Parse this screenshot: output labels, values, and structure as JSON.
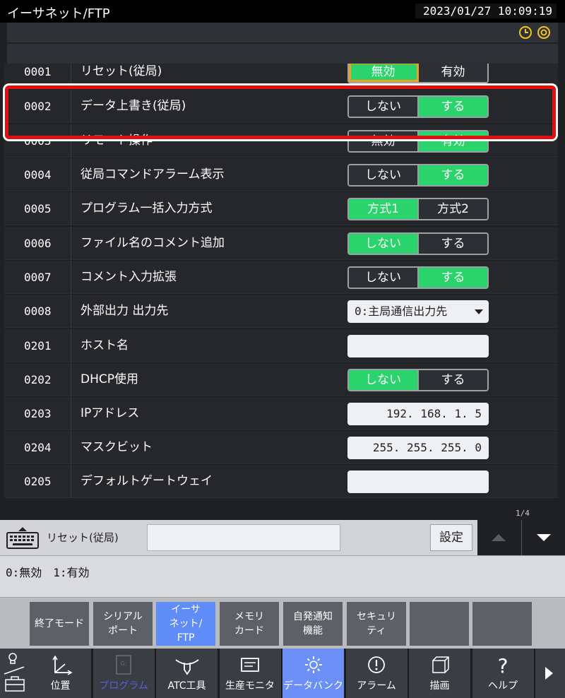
{
  "window": {
    "title": "イーサネット/FTP",
    "datetime": "2023/01/27 10:09:19"
  },
  "params": [
    {
      "no": "0001",
      "name": "リセット(従局)",
      "kind": "toggle",
      "options": [
        "無効",
        "有効"
      ],
      "selected": 0,
      "cursor": true
    },
    {
      "no": "0002",
      "name": "データ上書き(従局)",
      "kind": "toggle",
      "options": [
        "しない",
        "する"
      ],
      "selected": 1
    },
    {
      "no": "0003",
      "name": "リモート操作",
      "kind": "toggle",
      "options": [
        "無効",
        "有効"
      ],
      "selected": 1
    },
    {
      "no": "0004",
      "name": "従局コマンドアラーム表示",
      "kind": "toggle",
      "options": [
        "しない",
        "する"
      ],
      "selected": 1
    },
    {
      "no": "0005",
      "name": "プログラム一括入力方式",
      "kind": "toggle",
      "options": [
        "方式1",
        "方式2"
      ],
      "selected": 0
    },
    {
      "no": "0006",
      "name": "ファイル名のコメント追加",
      "kind": "toggle",
      "options": [
        "しない",
        "する"
      ],
      "selected": 0
    },
    {
      "no": "0007",
      "name": "コメント入力拡張",
      "kind": "toggle",
      "options": [
        "しない",
        "する"
      ],
      "selected": 1
    },
    {
      "no": "0008",
      "name": "外部出力 出力先",
      "kind": "dropdown",
      "value": "0:主局通信出力先"
    },
    {
      "no": "0201",
      "name": "ホスト名",
      "kind": "text",
      "value": ""
    },
    {
      "no": "0202",
      "name": "DHCP使用",
      "kind": "toggle",
      "options": [
        "しない",
        "する"
      ],
      "selected": 0
    },
    {
      "no": "0203",
      "name": "IPアドレス",
      "kind": "text",
      "value": "192. 168. 1. 5"
    },
    {
      "no": "0204",
      "name": "マスクビット",
      "kind": "text",
      "value": "255. 255. 255. 0"
    },
    {
      "no": "0205",
      "name": "デフォルトゲートウェイ",
      "kind": "text",
      "value": ""
    }
  ],
  "input": {
    "label": "リセット(従局)",
    "value": "",
    "set_label": "設定",
    "page": "1/4"
  },
  "help": {
    "text": "0:無効　1:有効"
  },
  "fkeys": [
    {
      "label": "終了モード"
    },
    {
      "label": "シリアル\nポート"
    },
    {
      "label": "イーサ\nネット/\nFTP",
      "active": true
    },
    {
      "label": "メモリ\nカード"
    },
    {
      "label": "自発通知\n機能"
    },
    {
      "label": "セキュリ\nティ"
    },
    {
      "label": ""
    },
    {
      "label": ""
    }
  ],
  "nav": [
    {
      "label": "位置",
      "icon": "axis-icon"
    },
    {
      "label": "プログラム",
      "icon": "program-icon",
      "dim": true
    },
    {
      "label": "ATC工具",
      "icon": "tool-icon"
    },
    {
      "label": "生産モニタ",
      "icon": "monitor-icon"
    },
    {
      "label": "データバンク",
      "icon": "gear-icon",
      "active": true
    },
    {
      "label": "アラーム",
      "icon": "alarm-icon"
    },
    {
      "label": "描画",
      "icon": "cube-icon"
    },
    {
      "label": "ヘルプ",
      "icon": "question-icon"
    }
  ],
  "colors": {
    "on": "#2ad36b",
    "highlight": "#e01010",
    "active_tab": "#6c8ff5"
  }
}
